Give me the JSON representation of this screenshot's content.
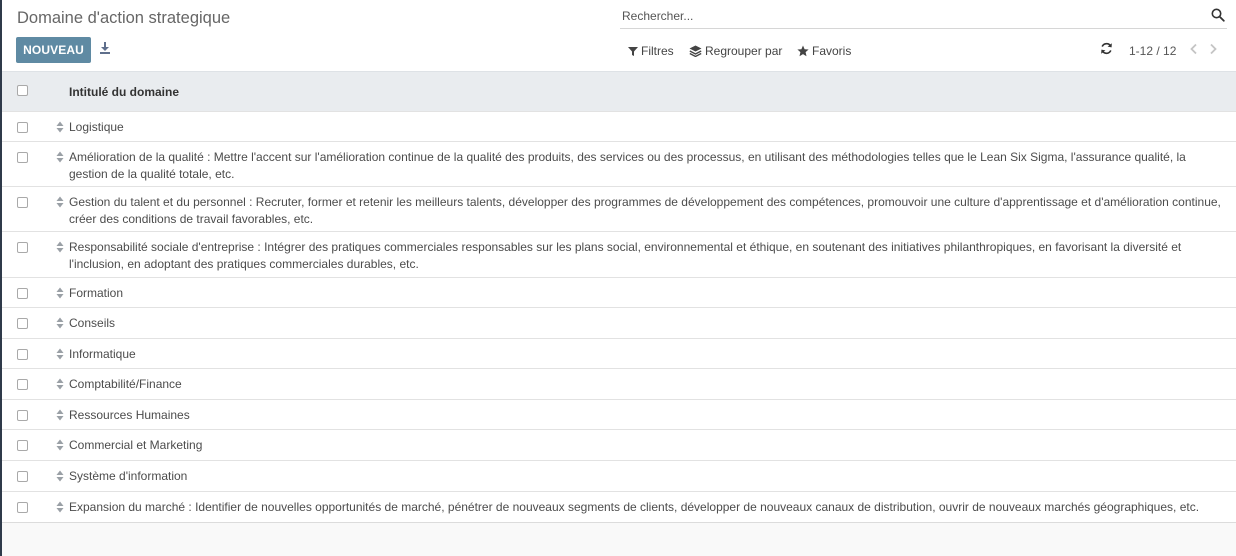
{
  "page": {
    "title": "Domaine d'action strategique"
  },
  "toolbar": {
    "new_label": "NOUVEAU",
    "download_icon": "download-icon"
  },
  "search": {
    "placeholder": "Rechercher...",
    "value": ""
  },
  "filters": {
    "filters_label": "Filtres",
    "group_by_label": "Regrouper par",
    "favorites_label": "Favoris"
  },
  "pager": {
    "value": "1-12 / 12"
  },
  "list": {
    "column_header": "Intitulé du domaine",
    "rows": [
      {
        "label": "Logistique"
      },
      {
        "label": "Amélioration de la qualité : Mettre l'accent sur l'amélioration continue de la qualité des produits, des services ou des processus, en utilisant des méthodologies telles que le Lean Six Sigma, l'assurance qualité, la gestion de la qualité totale, etc."
      },
      {
        "label": "Gestion du talent et du personnel : Recruter, former et retenir les meilleurs talents, développer des programmes de développement des compétences, promouvoir une culture d'apprentissage et d'amélioration continue, créer des conditions de travail favorables, etc."
      },
      {
        "label": "Responsabilité sociale d'entreprise : Intégrer des pratiques commerciales responsables sur les plans social, environnemental et éthique, en soutenant des initiatives philanthropiques, en favorisant la diversité et l'inclusion, en adoptant des pratiques commerciales durables, etc."
      },
      {
        "label": "Formation"
      },
      {
        "label": "Conseils"
      },
      {
        "label": "Informatique"
      },
      {
        "label": "Comptabilité/Finance"
      },
      {
        "label": "Ressources Humaines"
      },
      {
        "label": "Commercial et Marketing"
      },
      {
        "label": "Système d'information"
      },
      {
        "label": "Expansion du marché : Identifier de nouvelles opportunités de marché, pénétrer de nouveaux segments de clients, développer de nouveaux canaux de distribution, ouvrir de nouveaux marchés géographiques, etc."
      }
    ]
  },
  "colors": {
    "primary": "#5f8aa3",
    "header_bg": "#e9ecef",
    "frame": "#2f3a4a"
  }
}
